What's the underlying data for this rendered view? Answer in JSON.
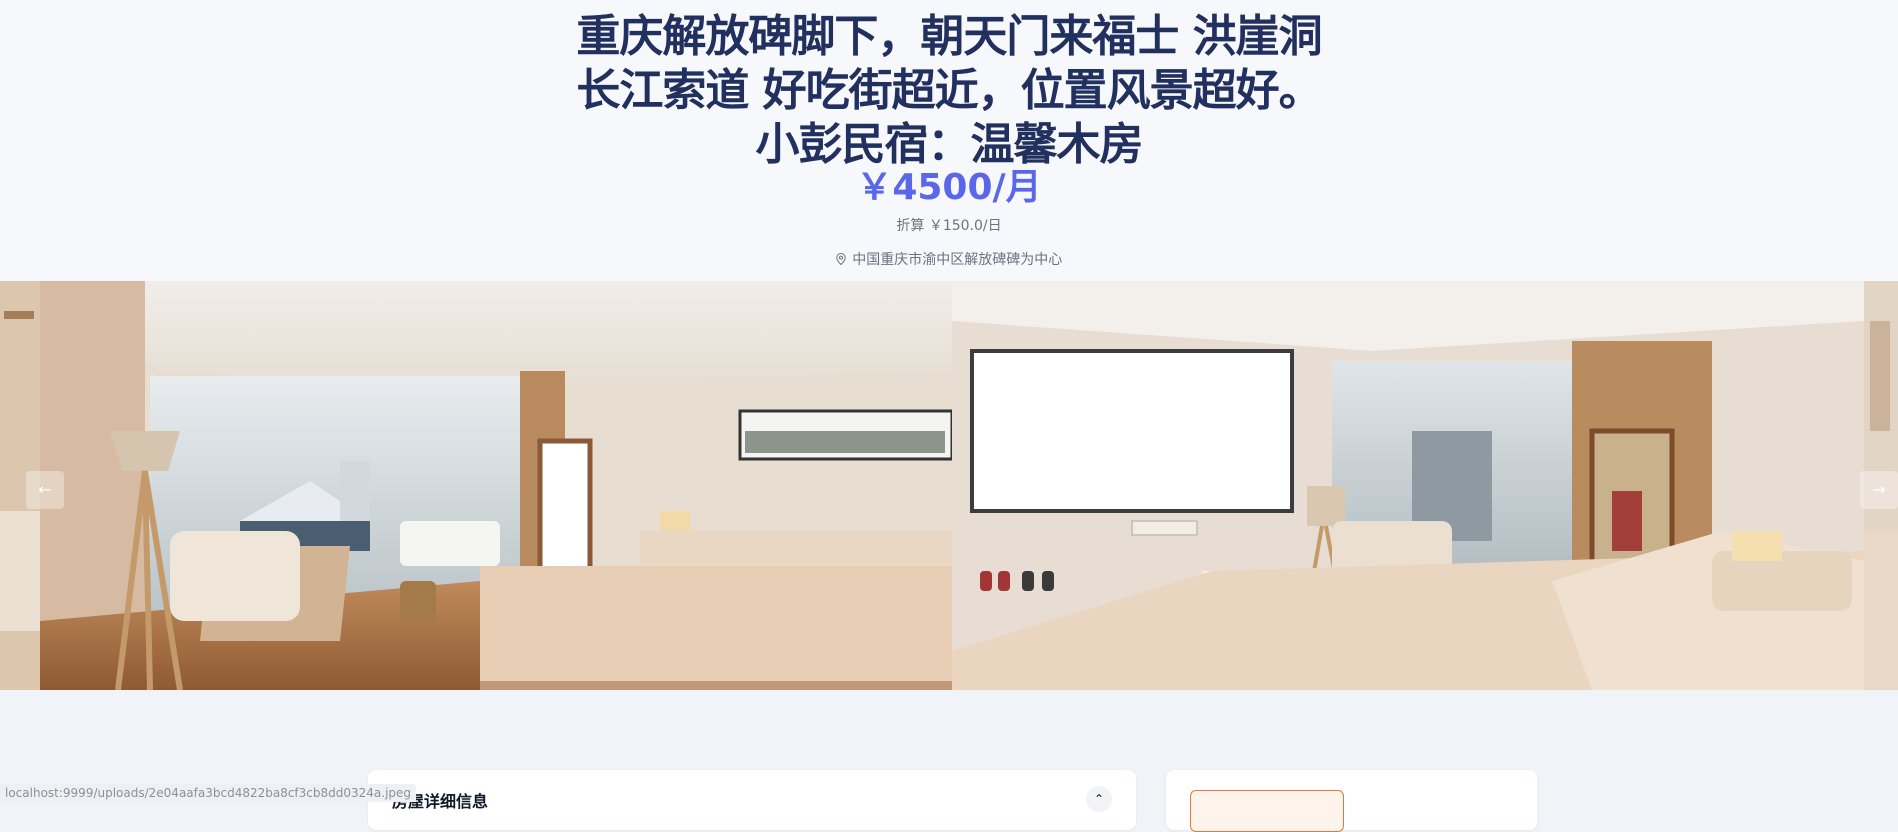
{
  "listing": {
    "title": "重庆解放碑脚下，朝天门来福士 洪崖洞 长江索道 好吃街超近，位置风景超好。小彭民宿：温馨木房",
    "price": "￥4500/月",
    "converted_price": "折算 ￥150.0/日",
    "location": "中国重庆市渝中区解放碑碑为中心"
  },
  "carousel": {
    "prev_icon": "arrow-left-icon",
    "next_icon": "arrow-right-icon",
    "prev_glyph": "←",
    "next_glyph": "→"
  },
  "details": {
    "title": "房屋详细信息",
    "collapse_glyph": "⌃"
  },
  "status_bar": {
    "url": "localhost:9999/uploads/2e04aafa3bcd4822ba8cf3cb8dd0324a.jpeg"
  }
}
